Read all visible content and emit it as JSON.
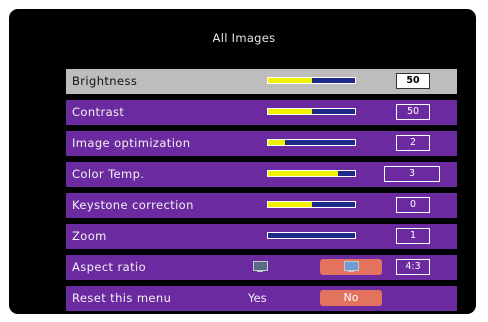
{
  "menu": {
    "title": "All Images",
    "rows": [
      {
        "label": "Brightness",
        "value": "50",
        "level": 0.5
      },
      {
        "label": "Contrast",
        "value": "50",
        "level": 0.5
      },
      {
        "label": "Image optimization",
        "value": "2",
        "level": 0.2
      },
      {
        "label": "Color Temp.",
        "value": "3",
        "level": 0.8
      },
      {
        "label": "Keystone correction",
        "value": "0",
        "level": 0.5
      },
      {
        "label": "Zoom",
        "value": "1",
        "level": 0.0
      },
      {
        "label": "Aspect ratio",
        "value": "4:3"
      },
      {
        "label": "Reset this menu",
        "yes": "Yes",
        "no": "No"
      }
    ]
  },
  "colors": {
    "row": "#6b2aa0",
    "selected_row": "#bdbdbd",
    "bar_fill": "#f2f200",
    "bar_track": "#1e2a8a",
    "highlight": "#e3735e"
  }
}
